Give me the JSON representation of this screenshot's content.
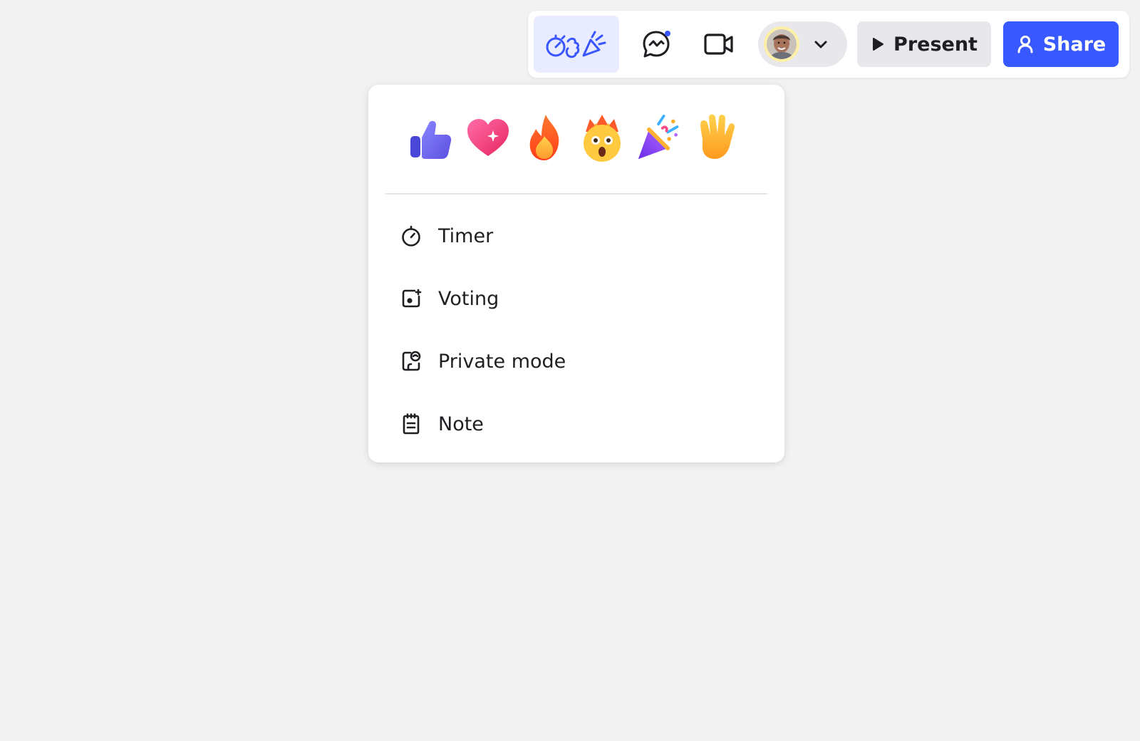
{
  "toolbar": {
    "collaboration_tools_icon": "timer-voting-celebrate-icon",
    "chat_icon": "chat-bubble-icon",
    "chat_has_notification": true,
    "video_icon": "video-camera-icon",
    "user_menu_icon": "chevron-down-icon",
    "present_label": "Present",
    "share_label": "Share",
    "accent_color": "#3859ff"
  },
  "reactions": [
    {
      "name": "thumbs-up",
      "glyph": "👍"
    },
    {
      "name": "sparkling-heart",
      "glyph": "💖"
    },
    {
      "name": "fire",
      "glyph": "🔥"
    },
    {
      "name": "mind-blown",
      "glyph": "🤯"
    },
    {
      "name": "party-popper",
      "glyph": "🎉"
    },
    {
      "name": "waving-hand",
      "glyph": "✋"
    }
  ],
  "menu": {
    "items": [
      {
        "label": "Timer",
        "icon": "stopwatch-icon"
      },
      {
        "label": "Voting",
        "icon": "voting-icon"
      },
      {
        "label": "Private mode",
        "icon": "private-mode-icon"
      },
      {
        "label": "Note",
        "icon": "note-icon"
      }
    ]
  }
}
